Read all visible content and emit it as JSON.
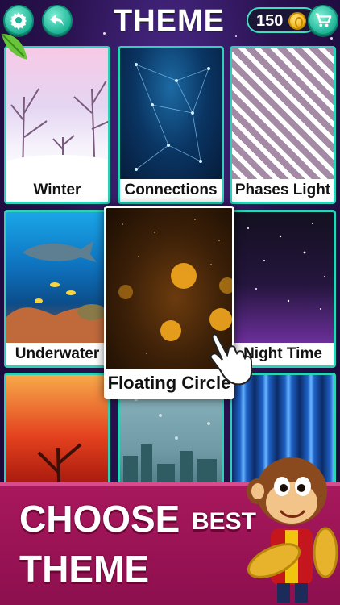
{
  "header": {
    "title": "THEME",
    "coins": "150",
    "settings_icon": "gear-icon",
    "back_icon": "back-arrow-icon",
    "shop_icon": "cart-icon"
  },
  "themes": [
    {
      "label": "Winter"
    },
    {
      "label": "Connections"
    },
    {
      "label": "Phases Light"
    },
    {
      "label": "Underwater"
    },
    {
      "label": "Floating Circle"
    },
    {
      "label": "Night Time"
    },
    {
      "label": ""
    },
    {
      "label": ""
    },
    {
      "label": ""
    }
  ],
  "banner": {
    "word1": "CHOOSE",
    "word2": "BEST",
    "word3": "THEME"
  },
  "colors": {
    "accent": "#2fd0b7",
    "banner": "#a8185d",
    "background": "#2a1250"
  }
}
